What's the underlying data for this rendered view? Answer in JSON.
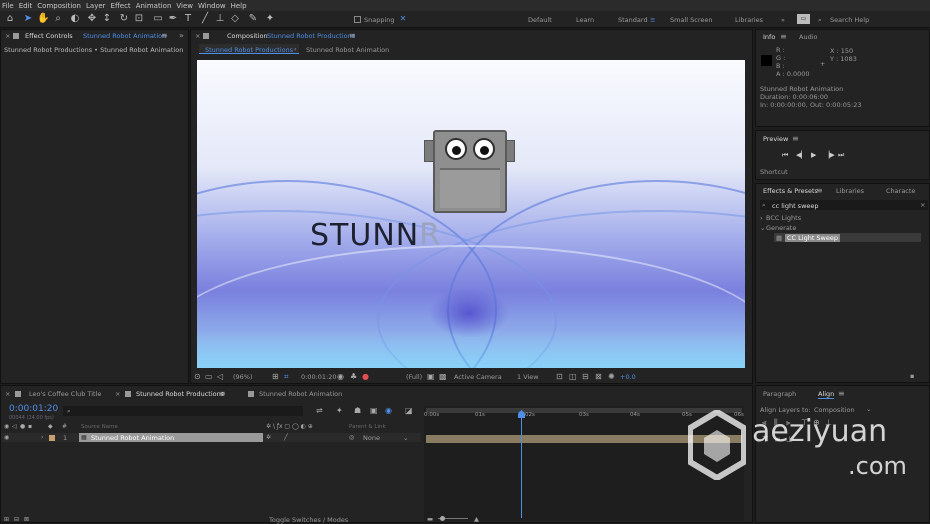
{
  "menu": [
    "File",
    "Edit",
    "Composition",
    "Layer",
    "Effect",
    "Animation",
    "View",
    "Window",
    "Help"
  ],
  "toolbar": {
    "snapping_label": "Snapping"
  },
  "workspaces": [
    "Default",
    "Learn",
    "Standard",
    "Small Screen",
    "Libraries"
  ],
  "search_help_placeholder": "Search Help",
  "effect_controls": {
    "tab": "Effect Controls",
    "tab_target": "Stunned Robot Animation",
    "breadcrumb": "Stunned Robot Productions • Stunned Robot Animation"
  },
  "composition": {
    "tab": "Composition",
    "tab_target": "Stunned Robot Productions",
    "crumb_active": "Stunned Robot Productions",
    "crumb_next": "Stunned Robot Animation"
  },
  "art": {
    "wordmark_dark": "STUNN",
    "wordmark_light": "R"
  },
  "viewer_bar": {
    "zoom": "(96%)",
    "timecode": "0:00:01:20",
    "resolution": "(Full)",
    "camera": "Active Camera",
    "views": "1 View",
    "exposure": "+0.0"
  },
  "info": {
    "tab": "Info",
    "tab2": "Audio",
    "r": "R :",
    "g": "G :",
    "b": "B :",
    "a": "A : 0.0000",
    "x": "X : 150",
    "y": "Y : 1083",
    "name": "Stunned Robot Animation",
    "duration": "Duration: 0:00:06:00",
    "inout": "In: 0:00:00:00, Out: 0:00:05:23"
  },
  "preview": {
    "tab": "Preview",
    "shortcut": "Shortcut"
  },
  "effects": {
    "tab": "Effects & Presets",
    "tab2": "Libraries",
    "tab3": "Characte",
    "search": "cc light sweep",
    "cat1": "BCC Lights",
    "cat2": "Generate",
    "item": "CC Light Sweep"
  },
  "align": {
    "tab1": "Paragraph",
    "tab2": "Align",
    "align_to_label": "Align Layers to:",
    "align_to_value": "Composition"
  },
  "timeline": {
    "tabs": [
      "Leo's Coffee Club Title",
      "Stunned Robot Productions",
      "Stunned Robot Animation"
    ],
    "timecode": "0:00:01:20",
    "timecode_sub": "00044 (24.00 fps)",
    "col_source": "Source Name",
    "col_parent": "Parent & Link",
    "layer_num": "1",
    "layer_name": "Stunned Robot Animation",
    "parent": "None",
    "ruler": [
      "0:00s",
      "01s",
      "02s",
      "03s",
      "04s",
      "05s",
      "06s"
    ],
    "toggle": "Toggle Switches / Modes"
  },
  "watermark": {
    "domain": "aeziyuan",
    "tld": ".com"
  }
}
